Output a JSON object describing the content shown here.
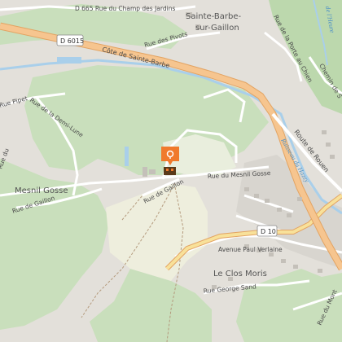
{
  "places": {
    "sainte_barbe_line1": "Sainte-Barbe-",
    "sainte_barbe_line2": "sur-Gaillon",
    "mesnil_gosse": "Mesnil Gosse",
    "le_clos_moris": "Le Clos Moris"
  },
  "roads": {
    "d665_champ": "D 665  Rue du Champ des Jardins",
    "d6015_shield": "D 6015",
    "cote_sainte_barbe": "Côte de Sainte-Barbe",
    "rue_des_pivots": "Rue des Pivots",
    "rue_porte_chien": "Rue de la Porte au Chien",
    "chemin_de_s": "Chemin de S",
    "rue_pipet": "Rue Pipet",
    "rue_demi_lune": "Rue de la Demi-Lune",
    "route_de_rouen": "Route de Rouen",
    "rue_mesnil_gosse": "Rue du Mesnil Gosse",
    "rue_de_gaillon_center": "Rue de Gaillon",
    "rue_de_gaillon_left": "Rue de Gaillon",
    "rue_du_left": "Rue du",
    "d10_shield": "D 10",
    "avenue_paul_verlaine": "Avenue Paul Verlaine",
    "rue_george_sand": "Rue George Sand",
    "rue_du_mont": "Rue du Mont"
  },
  "water": {
    "ruisseau": "Ruisseau du Hazey",
    "vallee_label": "de l'Heure"
  },
  "marker": {
    "icon": "location-pin-icon",
    "poi_icon": "castle-poi-icon",
    "color": "#f07a2c",
    "poi_color": "#5a3a1a"
  },
  "colors": {
    "forest": "#c9dfbc",
    "forest_dark": "#a9cb97",
    "built": "#d8d5cf",
    "field": "#eeeedd",
    "road_major": "#f6c58f",
    "road_major_casing": "#e3a463",
    "water": "#a9cfea"
  }
}
